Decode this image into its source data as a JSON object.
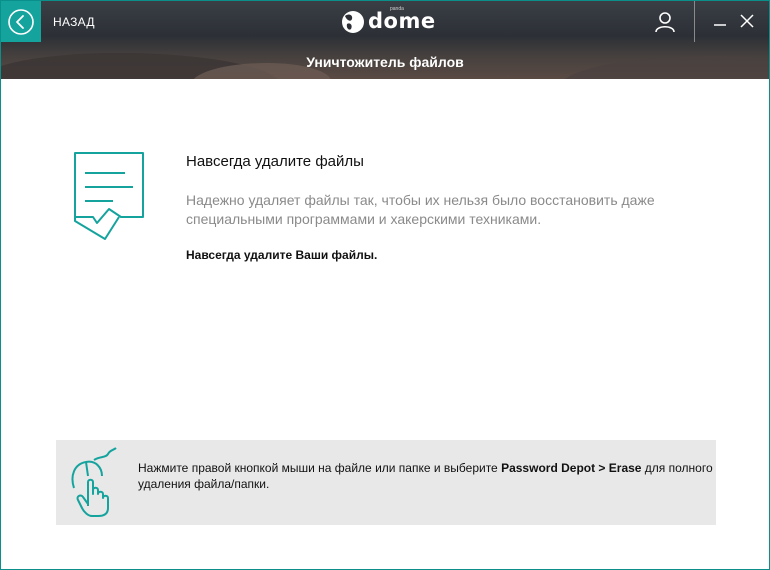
{
  "header": {
    "back_label": "НАЗАД",
    "logo_text": "dome",
    "logo_small": "panda",
    "page_title": "Уничтожитель файлов"
  },
  "main": {
    "heading": "Навсегда удалите файлы",
    "description": "Надежно удаляет файлы так, чтобы их нельзя было восстановить даже специальными программами и хакерскими техниками.",
    "strong_line": "Навсегда удалите Ваши файлы."
  },
  "tip": {
    "text_before": "Нажмите правой кнопкой мыши на файле или папке и выберите ",
    "text_bold": "Password Depot > Erase",
    "text_after": " для полного удаления файла/папки."
  },
  "colors": {
    "accent": "#15a39e",
    "tip_background": "#e8e8e8"
  },
  "icons": [
    "back-arrow-icon",
    "panda-logo-icon",
    "user-icon",
    "minimize-icon",
    "close-icon",
    "document-shred-icon",
    "mouse-hand-icon"
  ]
}
